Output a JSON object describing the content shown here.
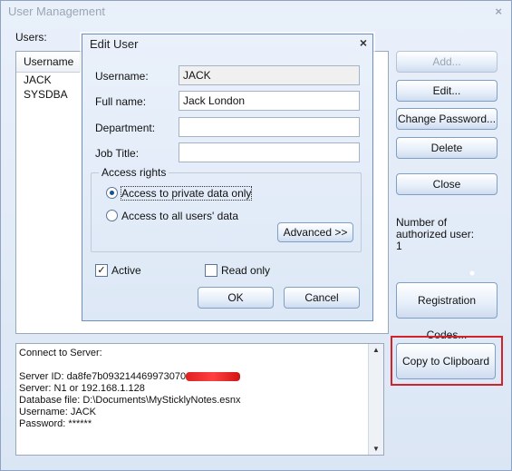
{
  "main_window": {
    "title": "User Management",
    "close_glyph": "×",
    "users_label": "Users:",
    "users_column_header": "Username",
    "users": [
      "JACK",
      "SYSDBA"
    ],
    "buttons": {
      "add": "Add...",
      "edit": "Edit...",
      "change_password": "Change Password...",
      "delete": "Delete",
      "close": "Close",
      "registration_codes": "Registration Codes...",
      "copy_to_clipboard": "Copy to Clipboard"
    },
    "authorized_users_label": "Number of authorized user:",
    "authorized_users_count": "1",
    "connection_info": {
      "line1": "Connect to Server:",
      "server_id_prefix": "Server ID: da8fe7b093214469973070",
      "server": "Server: N1 or 192.168.1.128",
      "database_file": "Database file: D:\\Documents\\MySticklyNotes.esnx",
      "username": "Username: JACK",
      "password": "Password: ******"
    },
    "highlight_color": "#d2232a"
  },
  "edit_dialog": {
    "title": "Edit User",
    "close_glyph": "×",
    "username_label": "Username:",
    "username_value": "JACK",
    "fullname_label": "Full name:",
    "fullname_value": "Jack London",
    "department_label": "Department:",
    "department_value": "",
    "jobtitle_label": "Job Title:",
    "jobtitle_value": "",
    "access_rights_label": "Access rights",
    "access_private": "Access to private data only",
    "access_all": "Access to all users' data",
    "advanced_button": "Advanced >>",
    "active_label": "Active",
    "read_only_label": "Read only",
    "ok_button": "OK",
    "cancel_button": "Cancel",
    "active_checked": true,
    "read_only_checked": false,
    "private_selected": true
  }
}
